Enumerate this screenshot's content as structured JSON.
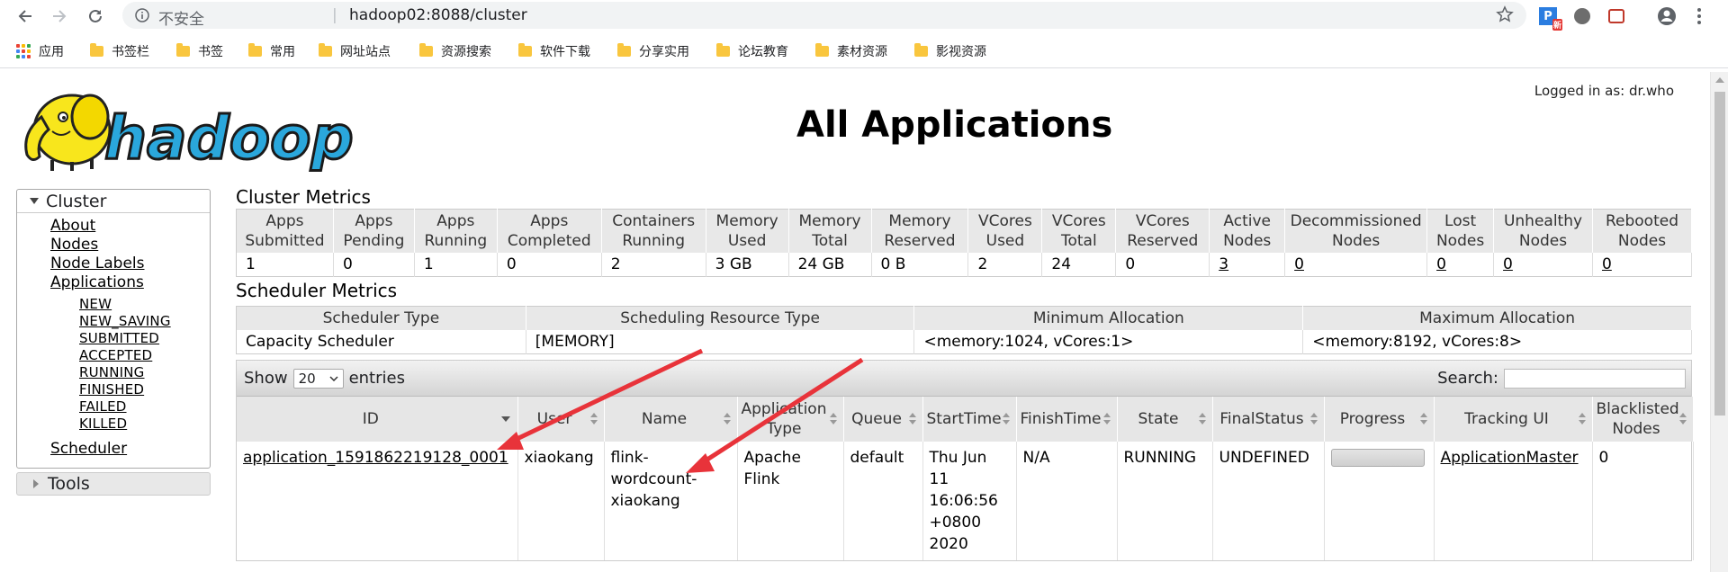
{
  "browser": {
    "insecure_label": "不安全",
    "url": "hadoop02:8088/cluster",
    "ext_badge": "新"
  },
  "bookmarks": {
    "apps_label": "应用",
    "items": [
      "书签栏",
      "书签",
      "常用",
      "网址站点",
      "资源搜索",
      "软件下载",
      "分享实用",
      "论坛教育",
      "素材资源",
      "影视资源"
    ]
  },
  "header": {
    "logged_in": "Logged in as: dr.who",
    "title": "All Applications",
    "logo_text": "hadoop"
  },
  "sidebar": {
    "cluster_label": "Cluster",
    "links": [
      "About",
      "Nodes",
      "Node Labels",
      "Applications"
    ],
    "app_states": [
      "NEW",
      "NEW_SAVING",
      "SUBMITTED",
      "ACCEPTED",
      "RUNNING",
      "FINISHED",
      "FAILED",
      "KILLED"
    ],
    "scheduler_label": "Scheduler",
    "tools_label": "Tools"
  },
  "cluster_metrics": {
    "title": "Cluster Metrics",
    "headers": [
      [
        "Apps",
        "Submitted"
      ],
      [
        "Apps",
        "Pending"
      ],
      [
        "Apps",
        "Running"
      ],
      [
        "Apps",
        "Completed"
      ],
      [
        "Containers",
        "Running"
      ],
      [
        "Memory",
        "Used"
      ],
      [
        "Memory",
        "Total"
      ],
      [
        "Memory",
        "Reserved"
      ],
      [
        "VCores",
        "Used"
      ],
      [
        "VCores",
        "Total"
      ],
      [
        "VCores",
        "Reserved"
      ],
      [
        "Active",
        "Nodes"
      ],
      [
        "Decommissioned",
        "Nodes"
      ],
      [
        "Lost",
        "Nodes"
      ],
      [
        "Unhealthy",
        "Nodes"
      ],
      [
        "Rebooted",
        "Nodes"
      ]
    ],
    "values": [
      "1",
      "0",
      "1",
      "0",
      "2",
      "3 GB",
      "24 GB",
      "0 B",
      "2",
      "24",
      "0",
      "3",
      "0",
      "0",
      "0",
      "0"
    ]
  },
  "scheduler_metrics": {
    "title": "Scheduler Metrics",
    "headers": [
      "Scheduler Type",
      "Scheduling Resource Type",
      "Minimum Allocation",
      "Maximum Allocation"
    ],
    "values": [
      "Capacity Scheduler",
      "[MEMORY]",
      "<memory:1024, vCores:1>",
      "<memory:8192, vCores:8>"
    ]
  },
  "datatable": {
    "show_label": "Show",
    "entries_value": "20",
    "entries_label": "entries",
    "search_label": "Search:",
    "headers": [
      [
        "ID"
      ],
      [
        "User"
      ],
      [
        "Name"
      ],
      [
        "Application",
        "Type"
      ],
      [
        "Queue"
      ],
      [
        "StartTime"
      ],
      [
        "FinishTime"
      ],
      [
        "State"
      ],
      [
        "FinalStatus"
      ],
      [
        "Progress"
      ],
      [
        "Tracking UI"
      ],
      [
        "Blacklisted",
        "Nodes"
      ]
    ],
    "row": {
      "id": "application_1591862219128_0001",
      "user": "xiaokang",
      "name": [
        "flink-",
        "wordcount-",
        "xiaokang"
      ],
      "type": [
        "Apache",
        "Flink"
      ],
      "queue": "default",
      "start": [
        "Thu Jun",
        "11",
        "16:06:56",
        "+0800",
        "2020"
      ],
      "finish": "N/A",
      "state": "RUNNING",
      "final_status": "UNDEFINED",
      "progress": 0,
      "tracking": "ApplicationMaster",
      "blacklisted": "0"
    }
  },
  "colors": {
    "annotation_arrow": "#e8333a",
    "logo_elephant": "#f8e61c",
    "logo_text": "#2aa7dc"
  }
}
